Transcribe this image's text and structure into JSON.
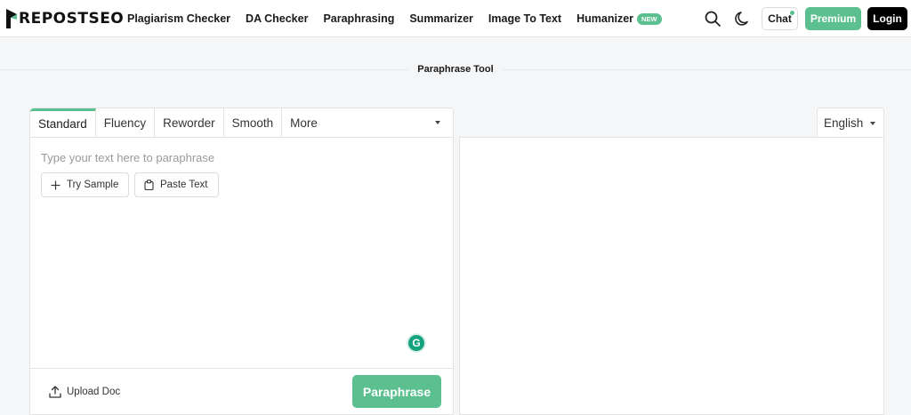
{
  "brand": {
    "name": "REPOSTSEO",
    "accent": "#5cbf8f"
  },
  "nav": {
    "items": [
      {
        "label": "Plagiarism Checker"
      },
      {
        "label": "DA Checker"
      },
      {
        "label": "Paraphrasing"
      },
      {
        "label": "Summarizer"
      },
      {
        "label": "Image To Text"
      },
      {
        "label": "Humanizer",
        "badge": "NEW"
      }
    ]
  },
  "header": {
    "search_icon": "search-icon",
    "theme_icon": "moon-icon",
    "chat_label": "Chat",
    "premium_label": "Premium",
    "login_label": "Login"
  },
  "page": {
    "title": "Paraphrase Tool"
  },
  "editor": {
    "tabs": [
      {
        "label": "Standard",
        "active": true
      },
      {
        "label": "Fluency"
      },
      {
        "label": "Reworder"
      },
      {
        "label": "Smooth"
      }
    ],
    "more_label": "More",
    "input_placeholder": "Type your text here to paraphrase",
    "try_sample_label": "Try Sample",
    "paste_text_label": "Paste Text",
    "upload_label": "Upload Doc",
    "paraphrase_label": "Paraphrase",
    "grammarly_letter": "G"
  },
  "output": {
    "language": "English"
  }
}
